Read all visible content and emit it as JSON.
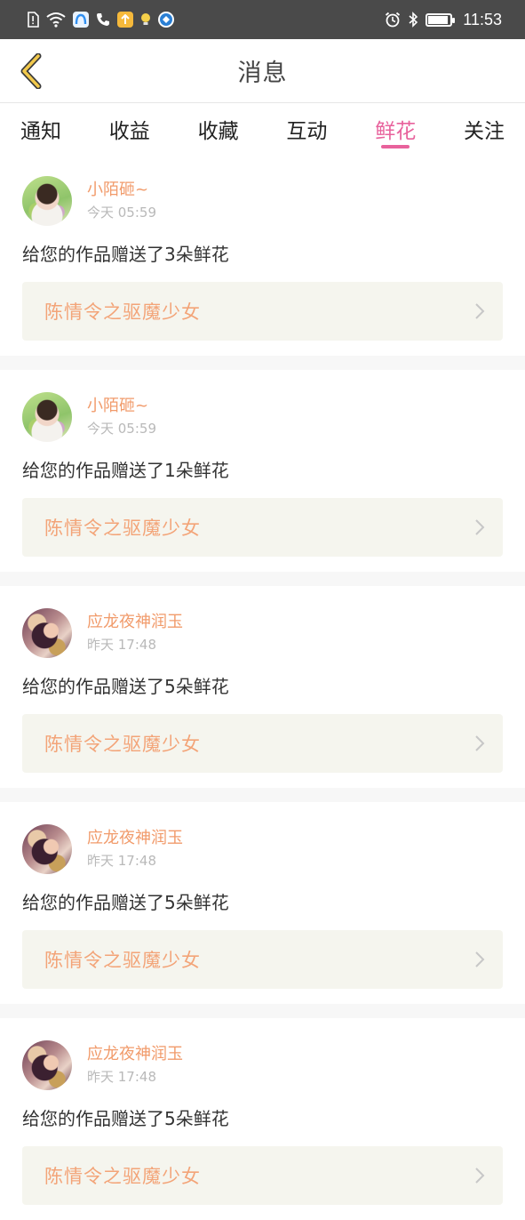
{
  "status_bar": {
    "time": "11:53",
    "app_icons": [
      "sim-alert-icon",
      "wifi-icon",
      "app-blue-icon",
      "phone-icon",
      "app-yellow-icon",
      "bulb-icon",
      "app-round-blue-icon"
    ],
    "right_icons": [
      "alarm-icon",
      "bluetooth-icon",
      "battery-icon"
    ],
    "battery_level": 0.9
  },
  "header": {
    "title": "消息"
  },
  "tabs": [
    {
      "label": "通知",
      "active": false
    },
    {
      "label": "收益",
      "active": false
    },
    {
      "label": "收藏",
      "active": false
    },
    {
      "label": "互动",
      "active": false
    },
    {
      "label": "鲜花",
      "active": true
    },
    {
      "label": "关注",
      "active": false
    }
  ],
  "messages": [
    {
      "user": "小陌砸~",
      "time": "今天 05:59",
      "text": "给您的作品赠送了3朵鲜花",
      "work": "陈情令之驱魔少女",
      "avatar": "girl"
    },
    {
      "user": "小陌砸~",
      "time": "今天 05:59",
      "text": "给您的作品赠送了1朵鲜花",
      "work": "陈情令之驱魔少女",
      "avatar": "girl"
    },
    {
      "user": "应龙夜神润玉",
      "time": "昨天 17:48",
      "text": "给您的作品赠送了5朵鲜花",
      "work": "陈情令之驱魔少女",
      "avatar": "dragon"
    },
    {
      "user": "应龙夜神润玉",
      "time": "昨天 17:48",
      "text": "给您的作品赠送了5朵鲜花",
      "work": "陈情令之驱魔少女",
      "avatar": "dragon"
    },
    {
      "user": "应龙夜神润玉",
      "time": "昨天 17:48",
      "text": "给您的作品赠送了5朵鲜花",
      "work": "陈情令之驱魔少女",
      "avatar": "dragon"
    }
  ],
  "colors": {
    "accent": "#e8629c",
    "username": "#f19b6b",
    "work_title": "#f3a478",
    "card_bg": "#f5f5ee",
    "back_chevron": "#f2c94c"
  }
}
